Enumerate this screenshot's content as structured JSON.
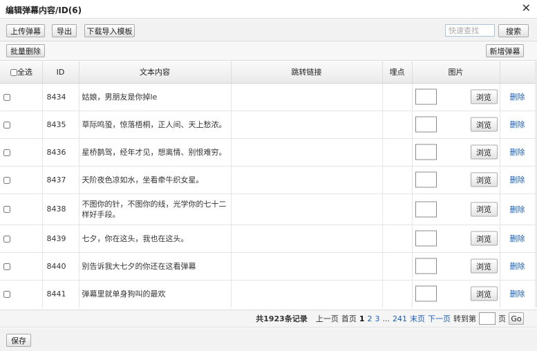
{
  "dialog": {
    "title": "编辑弹幕内容/ID(6)",
    "close_glyph": "✕"
  },
  "toolbar": {
    "upload_label": "上传弹幕",
    "export_label": "导出",
    "download_template_label": "下载导入模板",
    "search_placeholder": "快速查找",
    "search_label": "搜索"
  },
  "toolbar2": {
    "batch_delete_label": "批量删除",
    "add_label": "新增弹幕"
  },
  "table": {
    "headers": {
      "select_all": "全选",
      "id": "ID",
      "text": "文本内容",
      "link": "跳转链接",
      "point": "埋点",
      "image": "图片"
    },
    "browse_label": "浏览",
    "delete_label": "删除",
    "rows": [
      {
        "id": "8434",
        "text": "姑娘，男朋友是你掉le",
        "link": "",
        "point": ""
      },
      {
        "id": "8435",
        "text": "草际鸣蛩，惊落梧桐，正人间、天上愁浓。",
        "link": "",
        "point": ""
      },
      {
        "id": "8436",
        "text": "星桥鹊驾，经年才见，想离情、别恨难穷。",
        "link": "",
        "point": ""
      },
      {
        "id": "8437",
        "text": "天阶夜色凉如水，坐看牵牛织女星。",
        "link": "",
        "point": ""
      },
      {
        "id": "8438",
        "text": "不图你的针，不图你的线，光学你的七十二样好手段。",
        "link": "",
        "point": ""
      },
      {
        "id": "8439",
        "text": "七夕，你在这头，我也在这头。",
        "link": "",
        "point": ""
      },
      {
        "id": "8440",
        "text": "别告诉我大七夕的你还在这看弹幕",
        "link": "",
        "point": ""
      },
      {
        "id": "8441",
        "text": "弹幕里就单身狗叫的最欢",
        "link": "",
        "point": ""
      }
    ]
  },
  "pager": {
    "total": "共1923条记录",
    "prev": "上一页",
    "first": "首页",
    "current": "1",
    "p2": "2",
    "p3": "3",
    "ellipsis": "...",
    "last_num": "241",
    "last": "末页",
    "next": "下一页",
    "goto_label": "转到第",
    "page_unit": "页",
    "go_label": "Go"
  },
  "footer": {
    "save_label": "保存"
  }
}
